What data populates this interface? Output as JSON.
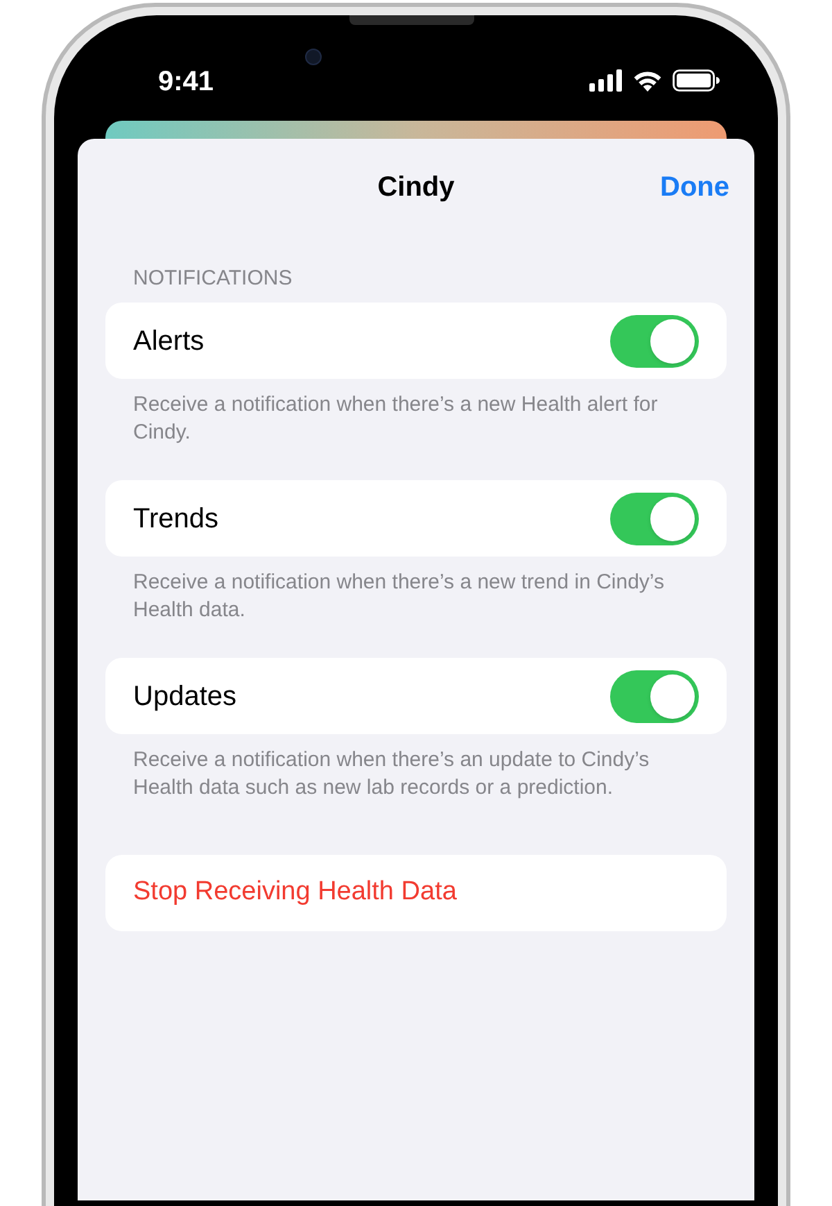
{
  "status_bar": {
    "time": "9:41"
  },
  "sheet": {
    "title": "Cindy",
    "done": "Done"
  },
  "section": {
    "header": "NOTIFICATIONS"
  },
  "settings": [
    {
      "label": "Alerts",
      "on": true,
      "description": "Receive a notification when there’s a new Health alert for Cindy."
    },
    {
      "label": "Trends",
      "on": true,
      "description": "Receive a notification when there’s a new trend in Cindy’s Health data."
    },
    {
      "label": "Updates",
      "on": true,
      "description": "Receive a notification when there’s an update to Cindy’s Health data such as new lab records or a prediction."
    }
  ],
  "stop_button": "Stop Receiving Health Data"
}
